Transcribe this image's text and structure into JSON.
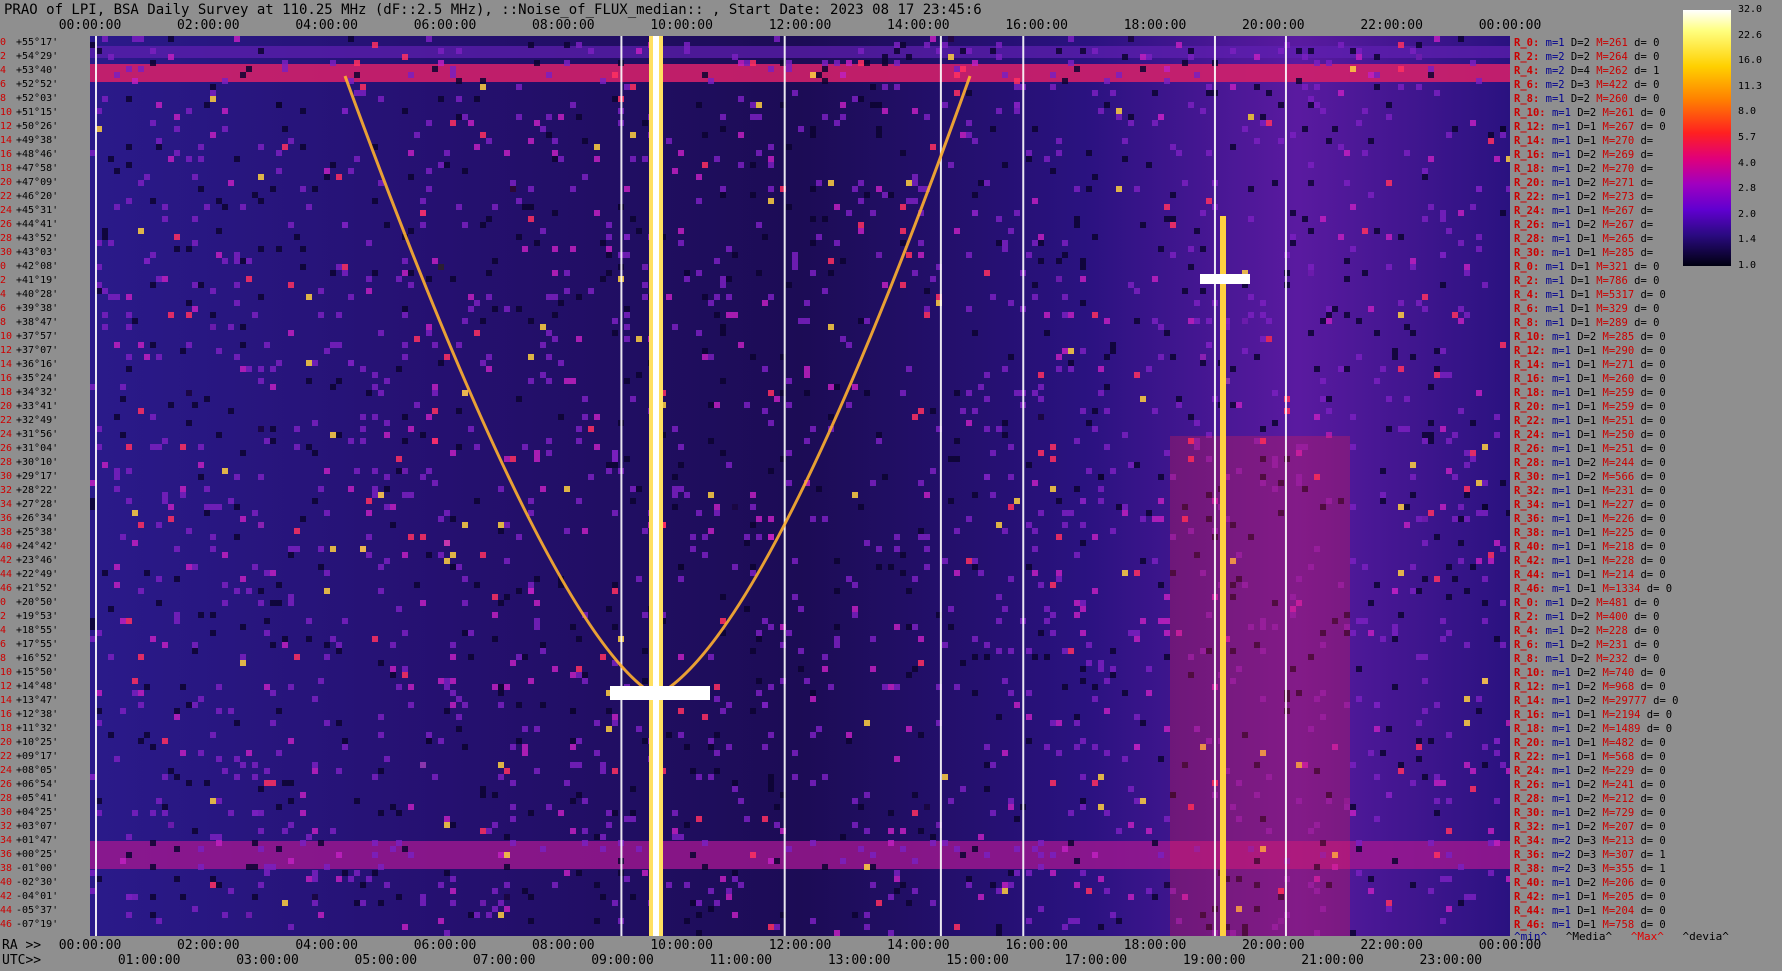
{
  "title": "PRAO of LPI, BSA Daily Survey at 110.25 MHz (dF::2.5 MHz), ::Noise_of_FLUX_median:: , Start Date: 2023 08 17 23:45:6",
  "top_axis": [
    "00:00:00",
    "02:00:00",
    "04:00:00",
    "06:00:00",
    "08:00:00",
    "10:00:00",
    "12:00:00",
    "14:00:00",
    "16:00:00",
    "18:00:00",
    "20:00:00",
    "22:00:00",
    "00:00:00"
  ],
  "bottom_axis_ra_label": "RA >>",
  "bottom_axis_ra": [
    "00:00:00",
    "02:00:00",
    "04:00:00",
    "06:00:00",
    "08:00:00",
    "10:00:00",
    "12:00:00",
    "14:00:00",
    "16:00:00",
    "18:00:00",
    "20:00:00",
    "22:00:00",
    "00:00:00"
  ],
  "bottom_axis_utc_label": "UTC>>",
  "bottom_axis_utc": [
    "01:00:00",
    "03:00:00",
    "05:00:00",
    "07:00:00",
    "09:00:00",
    "11:00:00",
    "13:00:00",
    "15:00:00",
    "17:00:00",
    "19:00:00",
    "21:00:00",
    "23:00:00"
  ],
  "declinations": [
    "+55°17'",
    "+54°29'",
    "+53°40'",
    "+52°52'",
    "+52°03'",
    "+51°15'",
    "+50°26'",
    "+49°38'",
    "+48°46'",
    "+47°58'",
    "+47°09'",
    "+46°20'",
    "+45°31'",
    "+44°41'",
    "+43°52'",
    "+43°03'",
    "+42°08'",
    "+41°19'",
    "+40°28'",
    "+39°38'",
    "+38°47'",
    "+37°57'",
    "+37°07'",
    "+36°16'",
    "+35°24'",
    "+34°32'",
    "+33°41'",
    "+32°49'",
    "+31°56'",
    "+31°04'",
    "+30°10'",
    "+29°17'",
    "+28°22'",
    "+27°28'",
    "+26°34'",
    "+25°38'",
    "+24°42'",
    "+23°46'",
    "+22°49'",
    "+21°52'",
    "+20°50'",
    "+19°53'",
    "+18°55'",
    "+17°55'",
    "+16°52'",
    "+15°50'",
    "+14°48'",
    "+13°47'",
    "+12°38'",
    "+11°32'",
    "+10°25'",
    "+09°17'",
    "+08°05'",
    "+06°54'",
    "+05°41'",
    "+04°25'",
    "+03°07'",
    "+01°47'",
    "+00°25'",
    "-01°00'",
    "-02°30'",
    "-04°01'",
    "-05°37'",
    "-07°19'"
  ],
  "channel_labels": [
    "0",
    "2",
    "4",
    "6",
    "8",
    "10",
    "12",
    "14",
    "16",
    "18",
    "20",
    "22",
    "24",
    "26",
    "28",
    "30",
    "0",
    "2",
    "4",
    "6",
    "8",
    "10",
    "12",
    "14",
    "16",
    "18",
    "20",
    "22",
    "24",
    "26",
    "28",
    "30",
    "32",
    "34",
    "36",
    "38",
    "40",
    "42",
    "44",
    "46",
    "0",
    "2",
    "4",
    "6",
    "8",
    "10",
    "12",
    "14",
    "16",
    "18",
    "20",
    "22",
    "24",
    "26",
    "28",
    "30",
    "32",
    "34",
    "36",
    "38",
    "40",
    "42",
    "44",
    "46"
  ],
  "rows": [
    {
      "label": "R_0:",
      "m": "m=1",
      "D": "D=2",
      "M": "M=261",
      "d": "d= 0"
    },
    {
      "label": "R_2:",
      "m": "m=2",
      "D": "D=2",
      "M": "M=264",
      "d": "d= 0"
    },
    {
      "label": "R_4:",
      "m": "m=2",
      "D": "D=4",
      "M": "M=262",
      "d": "d= 1"
    },
    {
      "label": "R_6:",
      "m": "m=2",
      "D": "D=3",
      "M": "M=422",
      "d": "d= 0"
    },
    {
      "label": "R_8:",
      "m": "m=1",
      "D": "D=2",
      "M": "M=260",
      "d": "d= 0"
    },
    {
      "label": "R_10:",
      "m": "m=1",
      "D": "D=2",
      "M": "M=261",
      "d": "d= 0"
    },
    {
      "label": "R_12:",
      "m": "m=1",
      "D": "D=1",
      "M": "M=267",
      "d": "d= 0"
    },
    {
      "label": "R_14:",
      "m": "m=1",
      "D": "D=1",
      "M": "M=270",
      "d": "d="
    },
    {
      "label": "R_16:",
      "m": "m=1",
      "D": "D=2",
      "M": "M=269",
      "d": "d="
    },
    {
      "label": "R_18:",
      "m": "m=1",
      "D": "D=2",
      "M": "M=270",
      "d": "d="
    },
    {
      "label": "R_20:",
      "m": "m=1",
      "D": "D=2",
      "M": "M=271",
      "d": "d="
    },
    {
      "label": "R_22:",
      "m": "m=1",
      "D": "D=2",
      "M": "M=273",
      "d": "d="
    },
    {
      "label": "R_24:",
      "m": "m=1",
      "D": "D=1",
      "M": "M=267",
      "d": "d="
    },
    {
      "label": "R_26:",
      "m": "m=1",
      "D": "D=2",
      "M": "M=267",
      "d": "d="
    },
    {
      "label": "R_28:",
      "m": "m=1",
      "D": "D=1",
      "M": "M=265",
      "d": "d="
    },
    {
      "label": "R_30:",
      "m": "m=1",
      "D": "D=1",
      "M": "M=285",
      "d": "d="
    },
    {
      "label": "R_0:",
      "m": "m=1",
      "D": "D=1",
      "M": "M=321",
      "d": "d= 0"
    },
    {
      "label": "R_2:",
      "m": "m=1",
      "D": "D=1",
      "M": "M=786",
      "d": "d= 0"
    },
    {
      "label": "R_4:",
      "m": "m=1",
      "D": "D=1",
      "M": "M=5317",
      "d": "d= 0"
    },
    {
      "label": "R_6:",
      "m": "m=1",
      "D": "D=1",
      "M": "M=329",
      "d": "d= 0"
    },
    {
      "label": "R_8:",
      "m": "m=1",
      "D": "D=1",
      "M": "M=289",
      "d": "d= 0"
    },
    {
      "label": "R_10:",
      "m": "m=1",
      "D": "D=2",
      "M": "M=285",
      "d": "d= 0"
    },
    {
      "label": "R_12:",
      "m": "m=1",
      "D": "D=1",
      "M": "M=290",
      "d": "d= 0"
    },
    {
      "label": "R_14:",
      "m": "m=1",
      "D": "D=1",
      "M": "M=271",
      "d": "d= 0"
    },
    {
      "label": "R_16:",
      "m": "m=1",
      "D": "D=1",
      "M": "M=260",
      "d": "d= 0"
    },
    {
      "label": "R_18:",
      "m": "m=1",
      "D": "D=1",
      "M": "M=259",
      "d": "d= 0"
    },
    {
      "label": "R_20:",
      "m": "m=1",
      "D": "D=1",
      "M": "M=259",
      "d": "d= 0"
    },
    {
      "label": "R_22:",
      "m": "m=1",
      "D": "D=1",
      "M": "M=251",
      "d": "d= 0"
    },
    {
      "label": "R_24:",
      "m": "m=1",
      "D": "D=1",
      "M": "M=250",
      "d": "d= 0"
    },
    {
      "label": "R_26:",
      "m": "m=1",
      "D": "D=1",
      "M": "M=251",
      "d": "d= 0"
    },
    {
      "label": "R_28:",
      "m": "m=1",
      "D": "D=2",
      "M": "M=244",
      "d": "d= 0"
    },
    {
      "label": "R_30:",
      "m": "m=1",
      "D": "D=2",
      "M": "M=566",
      "d": "d= 0"
    },
    {
      "label": "R_32:",
      "m": "m=1",
      "D": "D=1",
      "M": "M=231",
      "d": "d= 0"
    },
    {
      "label": "R_34:",
      "m": "m=1",
      "D": "D=1",
      "M": "M=227",
      "d": "d= 0"
    },
    {
      "label": "R_36:",
      "m": "m=1",
      "D": "D=1",
      "M": "M=226",
      "d": "d= 0"
    },
    {
      "label": "R_38:",
      "m": "m=1",
      "D": "D=1",
      "M": "M=225",
      "d": "d= 0"
    },
    {
      "label": "R_40:",
      "m": "m=1",
      "D": "D=1",
      "M": "M=218",
      "d": "d= 0"
    },
    {
      "label": "R_42:",
      "m": "m=1",
      "D": "D=1",
      "M": "M=228",
      "d": "d= 0"
    },
    {
      "label": "R_44:",
      "m": "m=1",
      "D": "D=1",
      "M": "M=214",
      "d": "d= 0"
    },
    {
      "label": "R_46:",
      "m": "m=1",
      "D": "D=1",
      "M": "M=1334",
      "d": "d= 0"
    },
    {
      "label": "R_0:",
      "m": "m=1",
      "D": "D=2",
      "M": "M=481",
      "d": "d= 0"
    },
    {
      "label": "R_2:",
      "m": "m=1",
      "D": "D=2",
      "M": "M=400",
      "d": "d= 0"
    },
    {
      "label": "R_4:",
      "m": "m=1",
      "D": "D=2",
      "M": "M=228",
      "d": "d= 0"
    },
    {
      "label": "R_6:",
      "m": "m=1",
      "D": "D=2",
      "M": "M=231",
      "d": "d= 0"
    },
    {
      "label": "R_8:",
      "m": "m=1",
      "D": "D=2",
      "M": "M=232",
      "d": "d= 0"
    },
    {
      "label": "R_10:",
      "m": "m=1",
      "D": "D=2",
      "M": "M=740",
      "d": "d= 0"
    },
    {
      "label": "R_12:",
      "m": "m=1",
      "D": "D=2",
      "M": "M=968",
      "d": "d= 0"
    },
    {
      "label": "R_14:",
      "m": "m=1",
      "D": "D=2",
      "M": "M=29777",
      "d": "d= 0"
    },
    {
      "label": "R_16:",
      "m": "m=1",
      "D": "D=1",
      "M": "M=2194",
      "d": "d= 0"
    },
    {
      "label": "R_18:",
      "m": "m=1",
      "D": "D=2",
      "M": "M=1489",
      "d": "d= 0"
    },
    {
      "label": "R_20:",
      "m": "m=1",
      "D": "D=1",
      "M": "M=482",
      "d": "d= 0"
    },
    {
      "label": "R_22:",
      "m": "m=1",
      "D": "D=1",
      "M": "M=568",
      "d": "d= 0"
    },
    {
      "label": "R_24:",
      "m": "m=1",
      "D": "D=2",
      "M": "M=229",
      "d": "d= 0"
    },
    {
      "label": "R_26:",
      "m": "m=1",
      "D": "D=2",
      "M": "M=241",
      "d": "d= 0"
    },
    {
      "label": "R_28:",
      "m": "m=1",
      "D": "D=2",
      "M": "M=212",
      "d": "d= 0"
    },
    {
      "label": "R_30:",
      "m": "m=1",
      "D": "D=2",
      "M": "M=729",
      "d": "d= 0"
    },
    {
      "label": "R_32:",
      "m": "m=1",
      "D": "D=2",
      "M": "M=207",
      "d": "d= 0"
    },
    {
      "label": "R_34:",
      "m": "m=2",
      "D": "D=3",
      "M": "M=213",
      "d": "d= 0"
    },
    {
      "label": "R_36:",
      "m": "m=2",
      "D": "D=3",
      "M": "M=307",
      "d": "d= 1"
    },
    {
      "label": "R_38:",
      "m": "m=2",
      "D": "D=3",
      "M": "M=355",
      "d": "d= 1"
    },
    {
      "label": "R_40:",
      "m": "m=1",
      "D": "D=2",
      "M": "M=206",
      "d": "d= 0"
    },
    {
      "label": "R_42:",
      "m": "m=1",
      "D": "D=1",
      "M": "M=205",
      "d": "d= 0"
    },
    {
      "label": "R_44:",
      "m": "m=1",
      "D": "D=1",
      "M": "M=204",
      "d": "d= 0"
    },
    {
      "label": "R_46:",
      "m": "m=1",
      "D": "D=1",
      "M": "M=758",
      "d": "d= 0"
    }
  ],
  "legend_footer": {
    "min": "^min^",
    "median": "^Media^",
    "max": "^Max^",
    "dev": "^devia^"
  },
  "colorbar_ticks": [
    "32.0",
    "22.6",
    "16.0",
    "11.3",
    "8.0",
    "5.7",
    "4.0",
    "2.8",
    "2.0",
    "1.4",
    "1.0"
  ]
}
